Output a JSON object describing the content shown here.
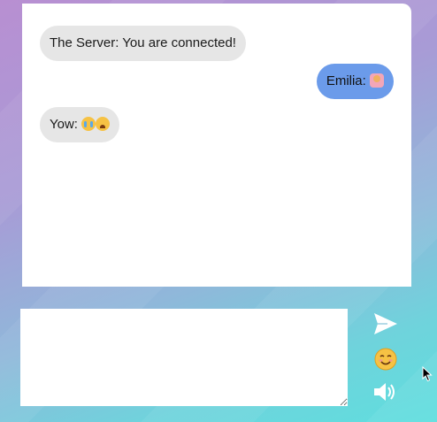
{
  "messages": [
    {
      "sender": "The Server",
      "text": "The Server: You are connected!",
      "direction": "incoming",
      "emojis": []
    },
    {
      "sender": "Emilia",
      "text": "Emilia: ",
      "direction": "outgoing",
      "emojis": [
        "person-raising-hand-emoji"
      ]
    },
    {
      "sender": "Yow",
      "text": "Yow: ",
      "direction": "incoming",
      "emojis": [
        "loudly-crying-face-emoji",
        "tired-face-emoji"
      ]
    }
  ],
  "composer": {
    "value": "",
    "placeholder": ""
  },
  "controls": {
    "send_icon": "send-icon",
    "emoji_icon": "smiling-face-icon",
    "sound_icon": "speaker-icon"
  },
  "colors": {
    "outgoing_bubble": "#6b9bea",
    "incoming_bubble": "#e6e6e6",
    "background_from": "#b88fd2",
    "background_to": "#5fdede"
  }
}
